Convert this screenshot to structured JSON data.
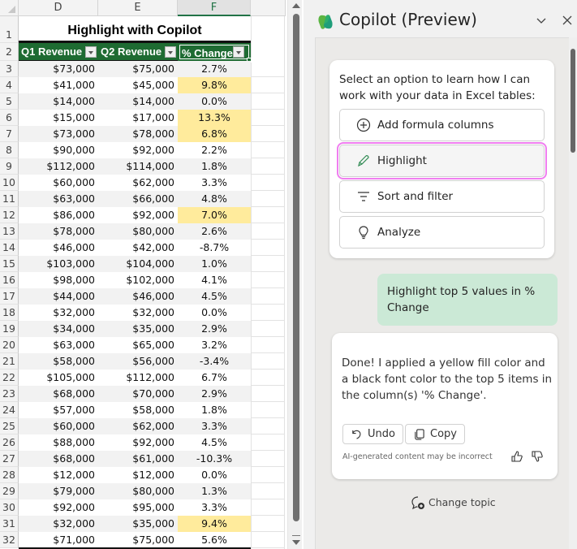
{
  "spreadsheet": {
    "columns": [
      "D",
      "E",
      "F"
    ],
    "selected_column": "F",
    "title": "Highlight with Copilot",
    "headers": [
      "Q1 Revenue",
      "Q2 Revenue",
      "% Change"
    ],
    "highlight_color": "#ffeb9c",
    "header_color": "#1e6b32",
    "rows": [
      {
        "row": "3",
        "q1": "$73,000",
        "q2": "$75,000",
        "change": "2.7%",
        "highlight": false
      },
      {
        "row": "4",
        "q1": "$41,000",
        "q2": "$45,000",
        "change": "9.8%",
        "highlight": true
      },
      {
        "row": "5",
        "q1": "$14,000",
        "q2": "$14,000",
        "change": "0.0%",
        "highlight": false
      },
      {
        "row": "6",
        "q1": "$15,000",
        "q2": "$17,000",
        "change": "13.3%",
        "highlight": true
      },
      {
        "row": "7",
        "q1": "$73,000",
        "q2": "$78,000",
        "change": "6.8%",
        "highlight": true
      },
      {
        "row": "8",
        "q1": "$90,000",
        "q2": "$92,000",
        "change": "2.2%",
        "highlight": false
      },
      {
        "row": "9",
        "q1": "$112,000",
        "q2": "$114,000",
        "change": "1.8%",
        "highlight": false
      },
      {
        "row": "10",
        "q1": "$60,000",
        "q2": "$62,000",
        "change": "3.3%",
        "highlight": false
      },
      {
        "row": "11",
        "q1": "$63,000",
        "q2": "$66,000",
        "change": "4.8%",
        "highlight": false
      },
      {
        "row": "12",
        "q1": "$86,000",
        "q2": "$92,000",
        "change": "7.0%",
        "highlight": true
      },
      {
        "row": "13",
        "q1": "$78,000",
        "q2": "$80,000",
        "change": "2.6%",
        "highlight": false
      },
      {
        "row": "14",
        "q1": "$46,000",
        "q2": "$42,000",
        "change": "-8.7%",
        "highlight": false
      },
      {
        "row": "15",
        "q1": "$103,000",
        "q2": "$104,000",
        "change": "1.0%",
        "highlight": false
      },
      {
        "row": "16",
        "q1": "$98,000",
        "q2": "$102,000",
        "change": "4.1%",
        "highlight": false
      },
      {
        "row": "17",
        "q1": "$44,000",
        "q2": "$46,000",
        "change": "4.5%",
        "highlight": false
      },
      {
        "row": "18",
        "q1": "$32,000",
        "q2": "$32,000",
        "change": "0.0%",
        "highlight": false
      },
      {
        "row": "19",
        "q1": "$34,000",
        "q2": "$35,000",
        "change": "2.9%",
        "highlight": false
      },
      {
        "row": "20",
        "q1": "$63,000",
        "q2": "$65,000",
        "change": "3.2%",
        "highlight": false
      },
      {
        "row": "21",
        "q1": "$58,000",
        "q2": "$56,000",
        "change": "-3.4%",
        "highlight": false
      },
      {
        "row": "22",
        "q1": "$105,000",
        "q2": "$112,000",
        "change": "6.7%",
        "highlight": false
      },
      {
        "row": "23",
        "q1": "$68,000",
        "q2": "$70,000",
        "change": "2.9%",
        "highlight": false
      },
      {
        "row": "24",
        "q1": "$57,000",
        "q2": "$58,000",
        "change": "1.8%",
        "highlight": false
      },
      {
        "row": "25",
        "q1": "$60,000",
        "q2": "$62,000",
        "change": "3.3%",
        "highlight": false
      },
      {
        "row": "26",
        "q1": "$88,000",
        "q2": "$92,000",
        "change": "4.5%",
        "highlight": false
      },
      {
        "row": "27",
        "q1": "$68,000",
        "q2": "$61,000",
        "change": "-10.3%",
        "highlight": false
      },
      {
        "row": "28",
        "q1": "$12,000",
        "q2": "$12,000",
        "change": "0.0%",
        "highlight": false
      },
      {
        "row": "29",
        "q1": "$79,000",
        "q2": "$80,000",
        "change": "1.3%",
        "highlight": false
      },
      {
        "row": "30",
        "q1": "$92,000",
        "q2": "$95,000",
        "change": "3.3%",
        "highlight": false
      },
      {
        "row": "31",
        "q1": "$32,000",
        "q2": "$35,000",
        "change": "9.4%",
        "highlight": true
      },
      {
        "row": "32",
        "q1": "$71,000",
        "q2": "$75,000",
        "change": "5.6%",
        "highlight": false
      }
    ]
  },
  "copilot": {
    "title": "Copilot (Preview)",
    "collapse_icon": "chevron-down-icon",
    "close_icon": "close-icon",
    "intro_text": "Select an option to learn how I can work with your data in Excel tables:",
    "options": [
      {
        "label": "Add formula columns",
        "icon": "plus-circle-icon",
        "active": false
      },
      {
        "label": "Highlight",
        "icon": "pen-icon",
        "active": true
      },
      {
        "label": "Sort and filter",
        "icon": "filter-icon",
        "active": false
      },
      {
        "label": "Analyze",
        "icon": "lightbulb-icon",
        "active": false
      }
    ],
    "user_message": "Highlight top 5 values in % Change",
    "response_text": "Done! I applied a yellow fill color and a black font color to the top 5 items in the column(s) '% Change'.",
    "undo_label": "Undo",
    "copy_label": "Copy",
    "disclaimer": "AI-generated content may be incorrect",
    "change_topic_label": "Change topic",
    "user_bubble_color": "#cbe9d6",
    "active_outline_color": "#f07ef0"
  }
}
